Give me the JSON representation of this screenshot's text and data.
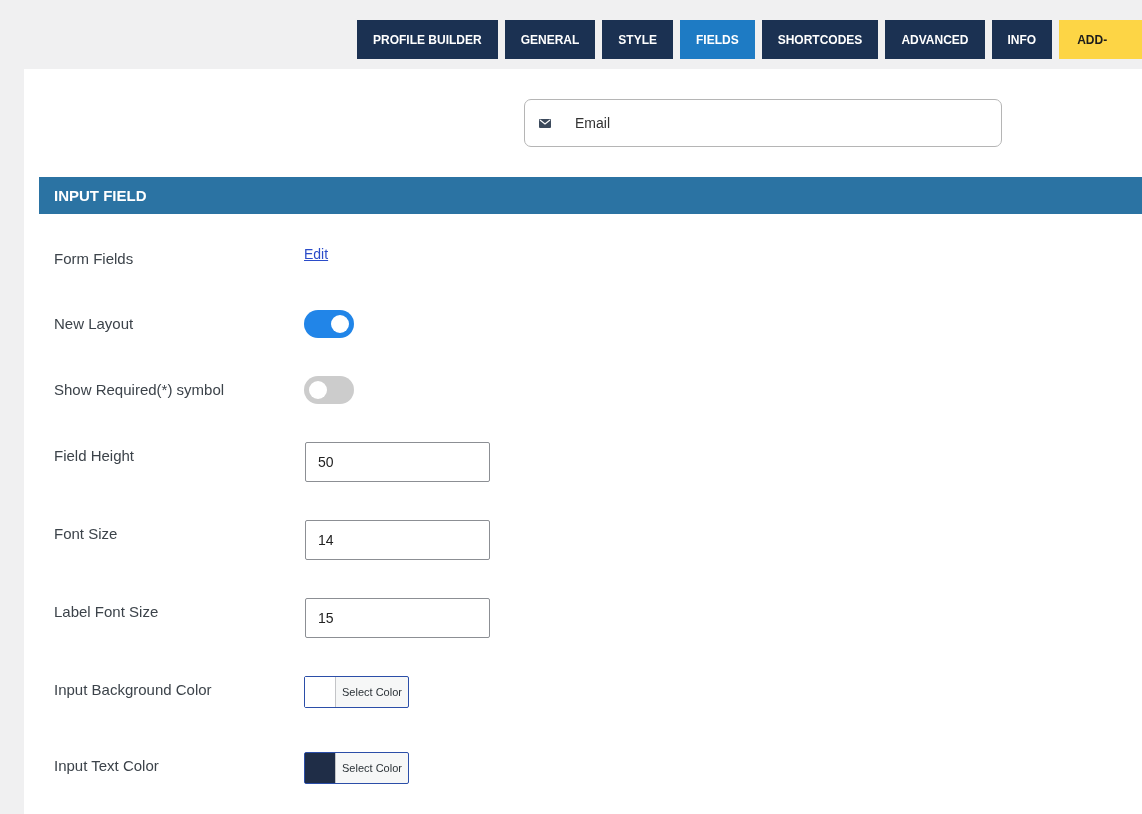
{
  "tabs": [
    {
      "label": "PROFILE BUILDER",
      "selected": false,
      "kind": "nav"
    },
    {
      "label": "GENERAL",
      "selected": false,
      "kind": "nav"
    },
    {
      "label": "STYLE",
      "selected": false,
      "kind": "nav"
    },
    {
      "label": "FIELDS",
      "selected": true,
      "kind": "nav"
    },
    {
      "label": "SHORTCODES",
      "selected": false,
      "kind": "nav"
    },
    {
      "label": "ADVANCED",
      "selected": false,
      "kind": "nav"
    },
    {
      "label": "INFO",
      "selected": false,
      "kind": "nav"
    },
    {
      "label": "ADD-",
      "selected": false,
      "kind": "addon"
    }
  ],
  "preview_field": {
    "value": "Email"
  },
  "section": {
    "title": "INPUT FIELD"
  },
  "settings": [
    {
      "kind": "link",
      "label": "Form Fields",
      "link": "Edit"
    },
    {
      "kind": "toggle",
      "label": "New Layout",
      "on": true
    },
    {
      "kind": "toggle",
      "label": "Show Required(*) symbol",
      "on": false
    },
    {
      "kind": "number",
      "label": "Field Height",
      "value": "50"
    },
    {
      "kind": "number",
      "label": "Font Size",
      "value": "14"
    },
    {
      "kind": "number",
      "label": "Label Font Size",
      "value": "15"
    },
    {
      "kind": "color",
      "label": "Input Background Color",
      "color": "#ffffff",
      "button": "Select Color"
    },
    {
      "kind": "color",
      "label": "Input Text Color",
      "color": "#1f2d47",
      "button": "Select Color"
    }
  ]
}
